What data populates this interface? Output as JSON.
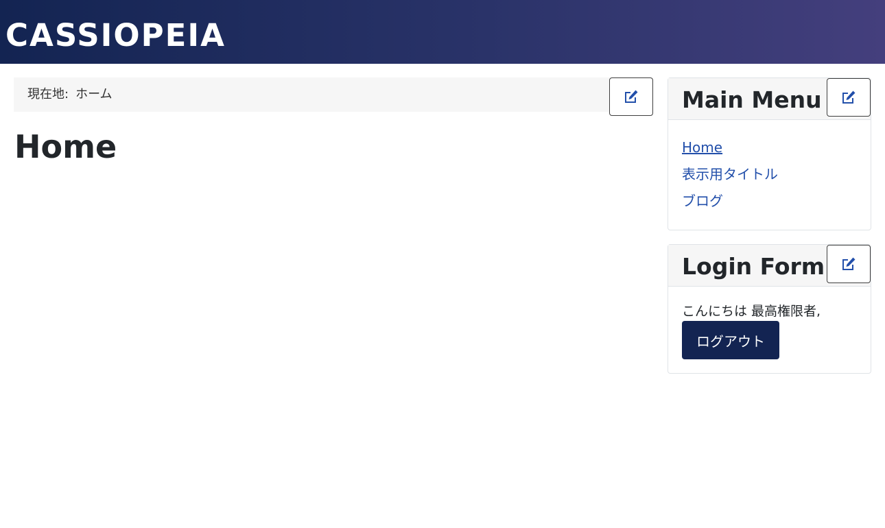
{
  "header": {
    "brand": "CASSIOPEIA"
  },
  "breadcrumb": {
    "label": "現在地:",
    "current": "ホーム",
    "edit_icon": "edit-icon"
  },
  "main": {
    "title": "Home"
  },
  "main_menu": {
    "title": "Main Menu",
    "edit_icon": "edit-icon",
    "items": [
      {
        "label": "Home",
        "current": true
      },
      {
        "label": "表示用タイトル",
        "current": false
      },
      {
        "label": "ブログ",
        "current": false
      }
    ]
  },
  "login_form": {
    "title": "Login Form",
    "edit_icon": "edit-icon",
    "greeting": "こんにちは 最高権限者,",
    "logout_label": "ログアウト"
  },
  "colors": {
    "header_start": "#132452",
    "header_end": "#443f7d",
    "link": "#224faa",
    "primary_button": "#132452"
  }
}
